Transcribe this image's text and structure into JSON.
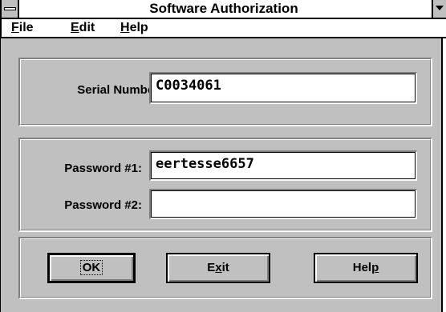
{
  "window": {
    "title": "Software Authorization"
  },
  "menu": {
    "items": [
      "File",
      "Edit",
      "Help"
    ]
  },
  "serial": {
    "label": "Serial Number:",
    "value": "C0034061"
  },
  "password1": {
    "label": "Password #1:",
    "value": "eertesse6657"
  },
  "password2": {
    "label": "Password #2:",
    "value": ""
  },
  "buttons": {
    "ok": "OK",
    "exit": "Exit",
    "help": "Help"
  }
}
